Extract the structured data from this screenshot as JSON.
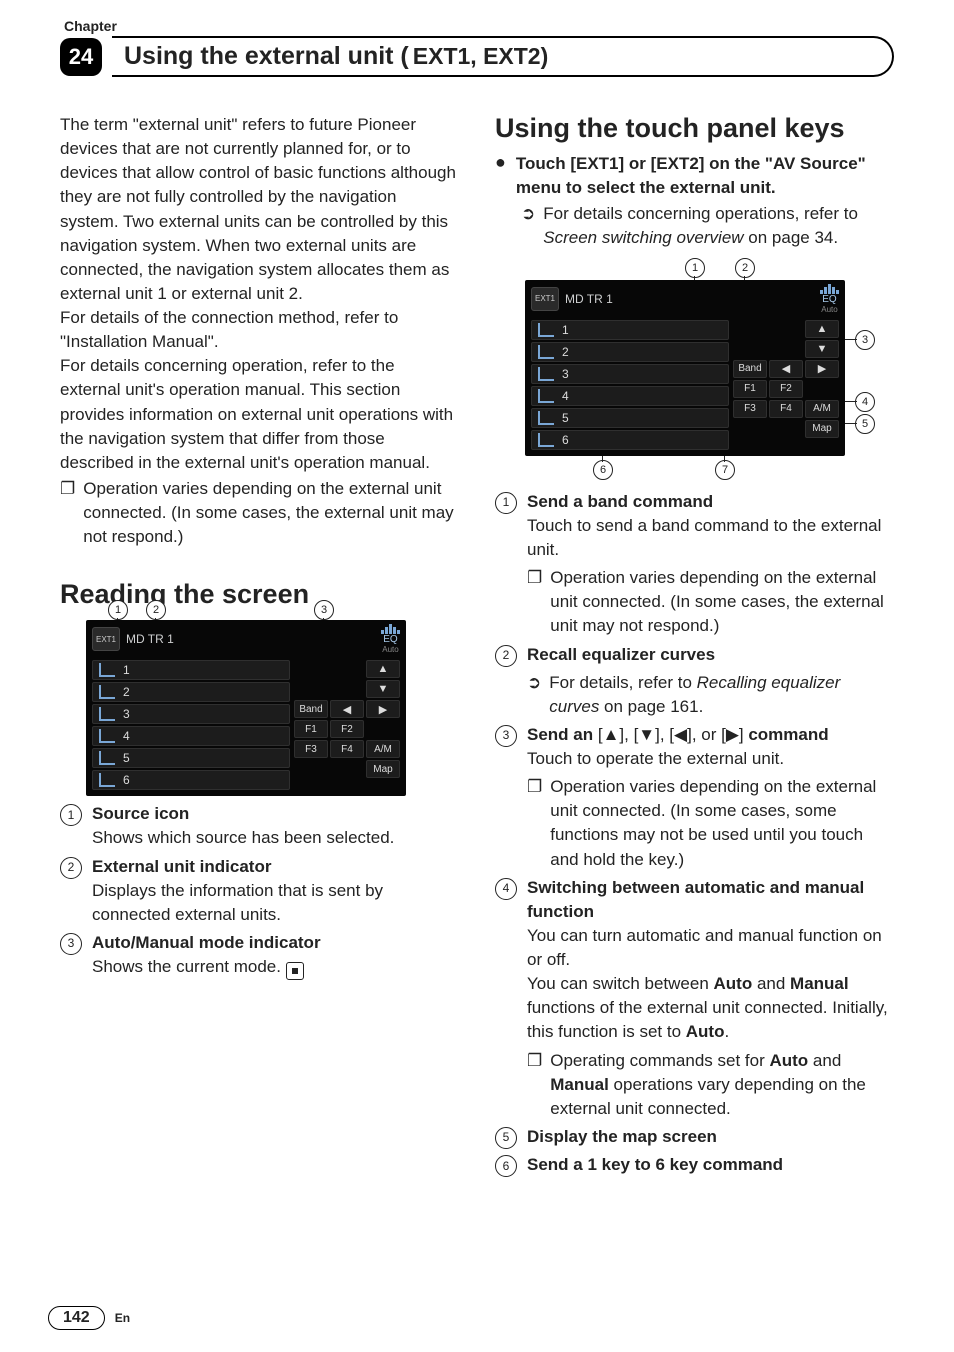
{
  "chapter_label": "Chapter",
  "chapter_number": "24",
  "header": {
    "strong": "Using the external unit (",
    "rest": "EXT1, EXT2)"
  },
  "intro": {
    "p1": "The term \"external unit\" refers to future Pioneer devices that are not currently planned for, or to devices that allow control of basic functions although they are not fully controlled by the navigation system. Two external units can be controlled by this navigation system. When two external units are connected, the navigation system allocates them as external unit 1 or external unit 2.",
    "p2": "For details of the connection method, refer to \"Installation Manual\".",
    "p3": "For details concerning operation, refer to the external unit's operation manual. This section provides information on external unit operations with the navigation system that differ from those described in the external unit's operation manual.",
    "note": "Operation varies depending on the external unit connected. (In some cases, the external unit may not respond.)"
  },
  "reading": {
    "heading": "Reading the screen",
    "items": [
      {
        "num": "1",
        "title": "Source icon",
        "desc": "Shows which source has been selected."
      },
      {
        "num": "2",
        "title": "External unit indicator",
        "desc": "Displays the information that is sent by connected external units."
      },
      {
        "num": "3",
        "title": "Auto/Manual mode indicator",
        "desc": "Shows the current mode."
      }
    ]
  },
  "touch": {
    "heading": "Using the touch panel keys",
    "lead": "Touch [EXT1] or [EXT2] on the \"AV Source\" menu to select the external unit.",
    "sub_pre": "For details concerning operations, refer to ",
    "sub_ital": "Screen switching overview",
    "sub_post": " on page 34.",
    "items": [
      {
        "num": "1",
        "title": "Send a band command",
        "desc": "Touch to send a band command to the external unit.",
        "notes": [
          "Operation varies depending on the external unit connected. (In some cases, the external unit may not respond.)"
        ]
      },
      {
        "num": "2",
        "title": "Recall equalizer curves",
        "ref_pre": "For details, refer to ",
        "ref_ital": "Recalling equalizer curves",
        "ref_post": " on page 161."
      },
      {
        "num": "3",
        "title_pre": "Send an ",
        "title_keys": "[▲], [▼], [◀], or [▶]",
        "title_post": " command",
        "desc": "Touch to operate the external unit.",
        "notes": [
          "Operation varies depending on the external unit connected. (In some cases, some functions may not be used until you touch and hold the key.)"
        ]
      },
      {
        "num": "4",
        "title": "Switching between automatic and manual function",
        "desc": "You can turn automatic and manual function on or off.",
        "desc2_pre": "You can switch between ",
        "desc2_b1": "Auto",
        "desc2_mid": " and ",
        "desc2_b2": "Manual",
        "desc2_post": " functions of the external unit connected. Initially, this function is set to ",
        "desc2_b3": "Auto",
        "desc2_end": ".",
        "notes_bold": {
          "pre": "Operating commands set for ",
          "b1": "Auto",
          "mid": " and ",
          "b2": "Manual",
          "post": " operations vary depending on the external unit connected."
        }
      },
      {
        "num": "5",
        "title": "Display the map screen"
      },
      {
        "num": "6",
        "title": "Send a 1 key to 6 key command"
      }
    ]
  },
  "shot": {
    "src_label": "EXT1",
    "status": "MD TR  1",
    "eq": "EQ",
    "eq_mode": "Auto",
    "list": [
      "1",
      "2",
      "3",
      "4",
      "5",
      "6"
    ],
    "pad_row3": [
      "Band",
      "◀",
      "▶"
    ],
    "pad_row4": [
      "F1",
      "F2",
      ""
    ],
    "pad_row5": [
      "F3",
      "F4",
      "A/M"
    ],
    "pad_row6": [
      "",
      "",
      "Map"
    ],
    "arrows": [
      "▲",
      "▼"
    ]
  },
  "callouts_left": [
    "1",
    "2",
    "3"
  ],
  "callouts_right": [
    "1",
    "2",
    "3",
    "4",
    "5",
    "6",
    "7"
  ],
  "footer": {
    "page": "142",
    "lang": "En"
  }
}
